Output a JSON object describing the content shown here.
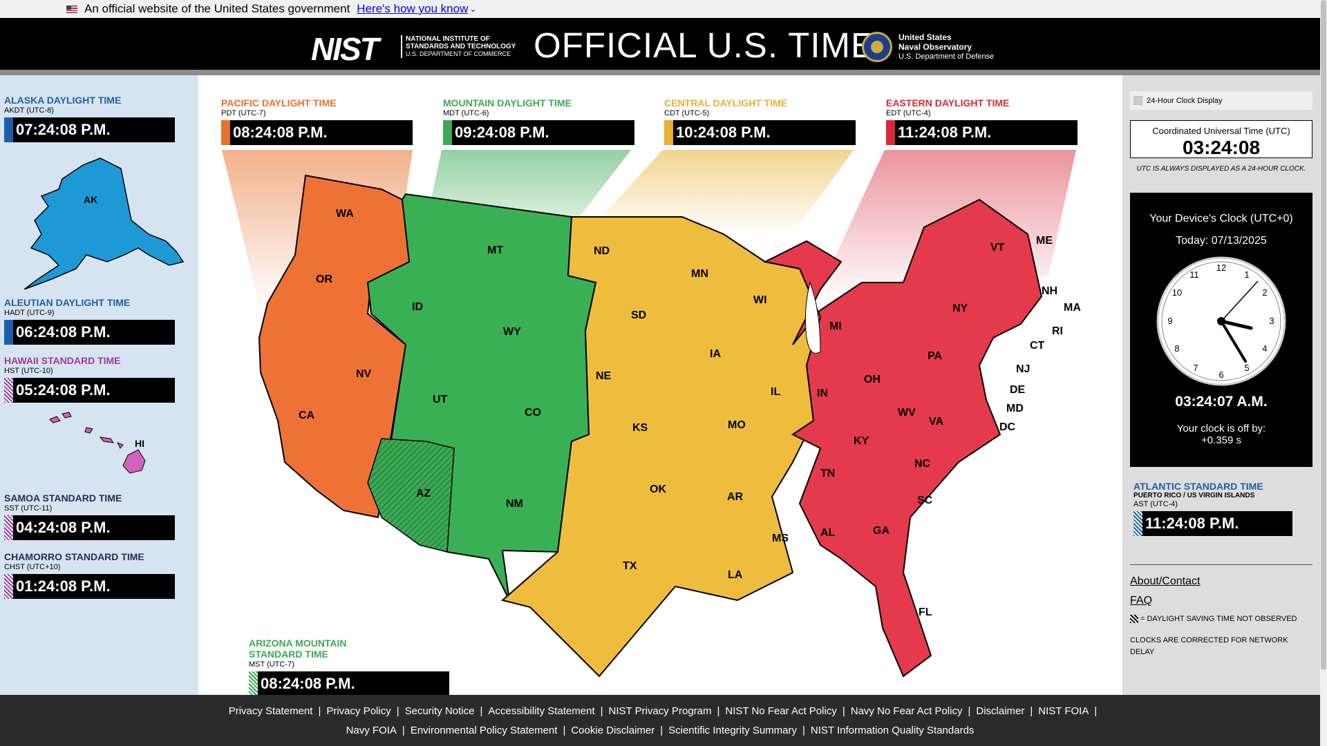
{
  "gov_banner": {
    "text": "An official website of the United States government",
    "link": "Here's how you know"
  },
  "header": {
    "nist_logo": "NIST",
    "nist_sub1": "NATIONAL INSTITUTE OF",
    "nist_sub2": "STANDARDS AND TECHNOLOGY",
    "nist_sub3": "U.S. DEPARTMENT OF COMMERCE",
    "title": "OFFICIAL U.S. TIME",
    "usno1": "United States",
    "usno2": "Naval Observatory",
    "usno3": "U.S. Department of Defense"
  },
  "left_zones": [
    {
      "name": "ALASKA DAYLIGHT TIME",
      "abbr": "AKDT (UTC-8)",
      "time": "07:24:08 P.M.",
      "color": "#1a5fa8"
    },
    {
      "name": "ALEUTIAN DAYLIGHT TIME",
      "abbr": "HADT (UTC-9)",
      "time": "06:24:08 P.M.",
      "color": "#1a5fa8"
    },
    {
      "name": "HAWAII STANDARD TIME",
      "abbr": "HST (UTC-10)",
      "time": "05:24:08 P.M.",
      "color": "#a03898"
    },
    {
      "name": "SAMOA STANDARD TIME",
      "abbr": "SST (UTC-11)",
      "time": "04:24:08 P.M.",
      "color": "#2a2a5a"
    },
    {
      "name": "CHAMORRO STANDARD TIME",
      "abbr": "CHST (UTC+10)",
      "time": "01:24:08 P.M.",
      "color": "#2a2a5a"
    }
  ],
  "map_zones": [
    {
      "name": "PACIFIC DAYLIGHT TIME",
      "abbr": "PDT (UTC-7)",
      "time": "08:24:08 P.M.",
      "color": "#e8702a"
    },
    {
      "name": "MOUNTAIN DAYLIGHT TIME",
      "abbr": "MDT (UTC-6)",
      "time": "09:24:08 P.M.",
      "color": "#3aaa55"
    },
    {
      "name": "CENTRAL DAYLIGHT TIME",
      "abbr": "CDT (UTC-5)",
      "time": "10:24:08 P.M.",
      "color": "#e8b030"
    },
    {
      "name": "EASTERN DAYLIGHT TIME",
      "abbr": "EDT (UTC-4)",
      "time": "11:24:08 P.M.",
      "color": "#d8283a"
    }
  ],
  "arizona": {
    "name1": "ARIZONA MOUNTAIN",
    "name2": "STANDARD TIME",
    "abbr": "MST (UTC-7)",
    "time": "08:24:08 P.M.",
    "color": "#3aaa55"
  },
  "labels": {
    "AK": "AK",
    "HI": "HI",
    "WA": "WA",
    "OR": "OR",
    "CA": "CA",
    "NV": "NV",
    "ID": "ID",
    "MT": "MT",
    "WY": "WY",
    "UT": "UT",
    "CO": "CO",
    "AZ": "AZ",
    "NM": "NM",
    "ND": "ND",
    "SD": "SD",
    "NE": "NE",
    "KS": "KS",
    "OK": "OK",
    "TX": "TX",
    "MN": "MN",
    "IA": "IA",
    "MO": "MO",
    "AR": "AR",
    "LA": "LA",
    "WI": "WI",
    "IL": "IL",
    "MS": "MS",
    "AL": "AL",
    "TN": "TN",
    "MI": "MI",
    "IN": "IN",
    "OH": "OH",
    "KY": "KY",
    "WV": "WV",
    "VA": "VA",
    "NC": "NC",
    "SC": "SC",
    "GA": "GA",
    "FL": "FL",
    "PA": "PA",
    "NY": "NY",
    "VT": "VT",
    "NH": "NH",
    "ME": "ME",
    "MA": "MA",
    "RI": "RI",
    "CT": "CT",
    "NJ": "NJ",
    "DE": "DE",
    "MD": "MD",
    "DC": "DC"
  },
  "right": {
    "toggle": "24-Hour Clock Display",
    "utc_label": "Coordinated Universal Time (UTC)",
    "utc_time": "03:24:08",
    "utc_note": "UTC IS ALWAYS DISPLAYED AS A 24-HOUR CLOCK.",
    "device_label": "Your Device's Clock (UTC+0)",
    "device_date": "Today: 07/13/2025",
    "device_time": "03:24:07 A.M.",
    "offset_line1": "Your clock is off by:",
    "offset_line2": "+0.359 s",
    "atlantic_name": "ATLANTIC STANDARD TIME",
    "atlantic_sub": "PUERTO RICO / US VIRGIN ISLANDS",
    "atlantic_abbr": "AST (UTC-4)",
    "atlantic_time": "11:24:08 P.M.",
    "about": "About/Contact",
    "faq": "FAQ",
    "dst_legend": "= DAYLIGHT SAVING TIME NOT OBSERVED",
    "network_note": "CLOCKS ARE CORRECTED FOR NETWORK DELAY"
  },
  "footer": {
    "row1": [
      "Privacy Statement",
      "Privacy Policy",
      "Security Notice",
      "Accessibility Statement",
      "NIST Privacy Program",
      "NIST No Fear Act Policy",
      "Navy No Fear Act Policy",
      "Disclaimer",
      "NIST FOIA"
    ],
    "row2": [
      "Navy FOIA",
      "Environmental Policy Statement",
      "Cookie Disclaimer",
      "Scientific Integrity Summary",
      "NIST Information Quality Standards"
    ]
  }
}
